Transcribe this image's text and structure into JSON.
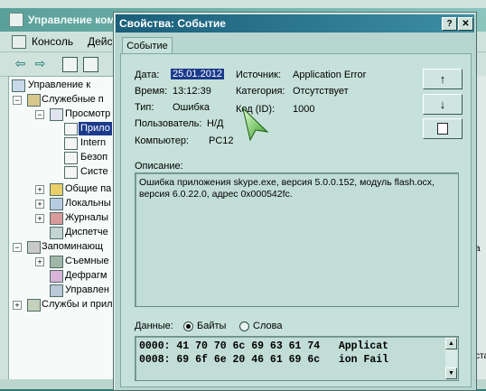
{
  "mmc": {
    "title": "Управление компьютером",
    "menu": {
      "console": "Консоль",
      "action": "Действие"
    },
    "tree": [
      {
        "label": "Управление к",
        "icon": "computer-management-icon"
      },
      {
        "label": "Служебные п",
        "icon": "tools-icon"
      },
      {
        "label": "Просмотр",
        "icon": "event-viewer-icon"
      },
      {
        "label": "Прило",
        "icon": "log-icon",
        "selected": true
      },
      {
        "label": "Intern",
        "icon": "log-icon"
      },
      {
        "label": "Безоп",
        "icon": "log-icon"
      },
      {
        "label": "Систе",
        "icon": "log-icon"
      },
      {
        "label": "Общие па",
        "icon": "shared-folder-icon"
      },
      {
        "label": "Локальны",
        "icon": "users-icon"
      },
      {
        "label": "Журналы",
        "icon": "performance-icon"
      },
      {
        "label": "Диспетче",
        "icon": "device-manager-icon"
      },
      {
        "label": "Запоминающ",
        "icon": "storage-icon"
      },
      {
        "label": "Съемные",
        "icon": "removable-storage-icon"
      },
      {
        "label": "Дефрагм",
        "icon": "defrag-icon"
      },
      {
        "label": "Управлен",
        "icon": "disk-management-icon"
      },
      {
        "label": "Службы и прил",
        "icon": "services-icon"
      }
    ],
    "right_fragments": {
      "a": "a",
      "b": "ста"
    }
  },
  "dialog": {
    "title": "Свойства: Событие",
    "help_label": "?",
    "close_label": "✕",
    "tab": "Событие",
    "fields": {
      "date_label": "Дата:",
      "date_value": "25.01.2012",
      "time_label": "Время:",
      "time_value": "13:12:39",
      "type_label": "Тип:",
      "type_value": "Ошибка",
      "user_label": "Пользователь:",
      "user_value": "Н/Д",
      "computer_label": "Компьютер:",
      "computer_value": "PC12",
      "source_label": "Источник:",
      "source_value": "Application Error",
      "category_label": "Категория:",
      "category_value": "Отсутствует",
      "id_label": "Код (ID):",
      "id_value": "1000"
    },
    "buttons": {
      "up": "↑",
      "down": "↓"
    },
    "description_label": "Описание:",
    "description_text": "Ошибка приложения skype.exe, версия 5.0.0.152, модуль flash.ocx, версия 6.0.22.0, адрес 0x000542fc.",
    "data_label": "Данные:",
    "radio_bytes": "Байты",
    "radio_words": "Слова",
    "hex_lines": [
      "0000: 41 70 70 6c 69 63 61 74   Applicat",
      "0008: 69 6f 6e 20 46 61 69 6c   ion Fail"
    ]
  }
}
